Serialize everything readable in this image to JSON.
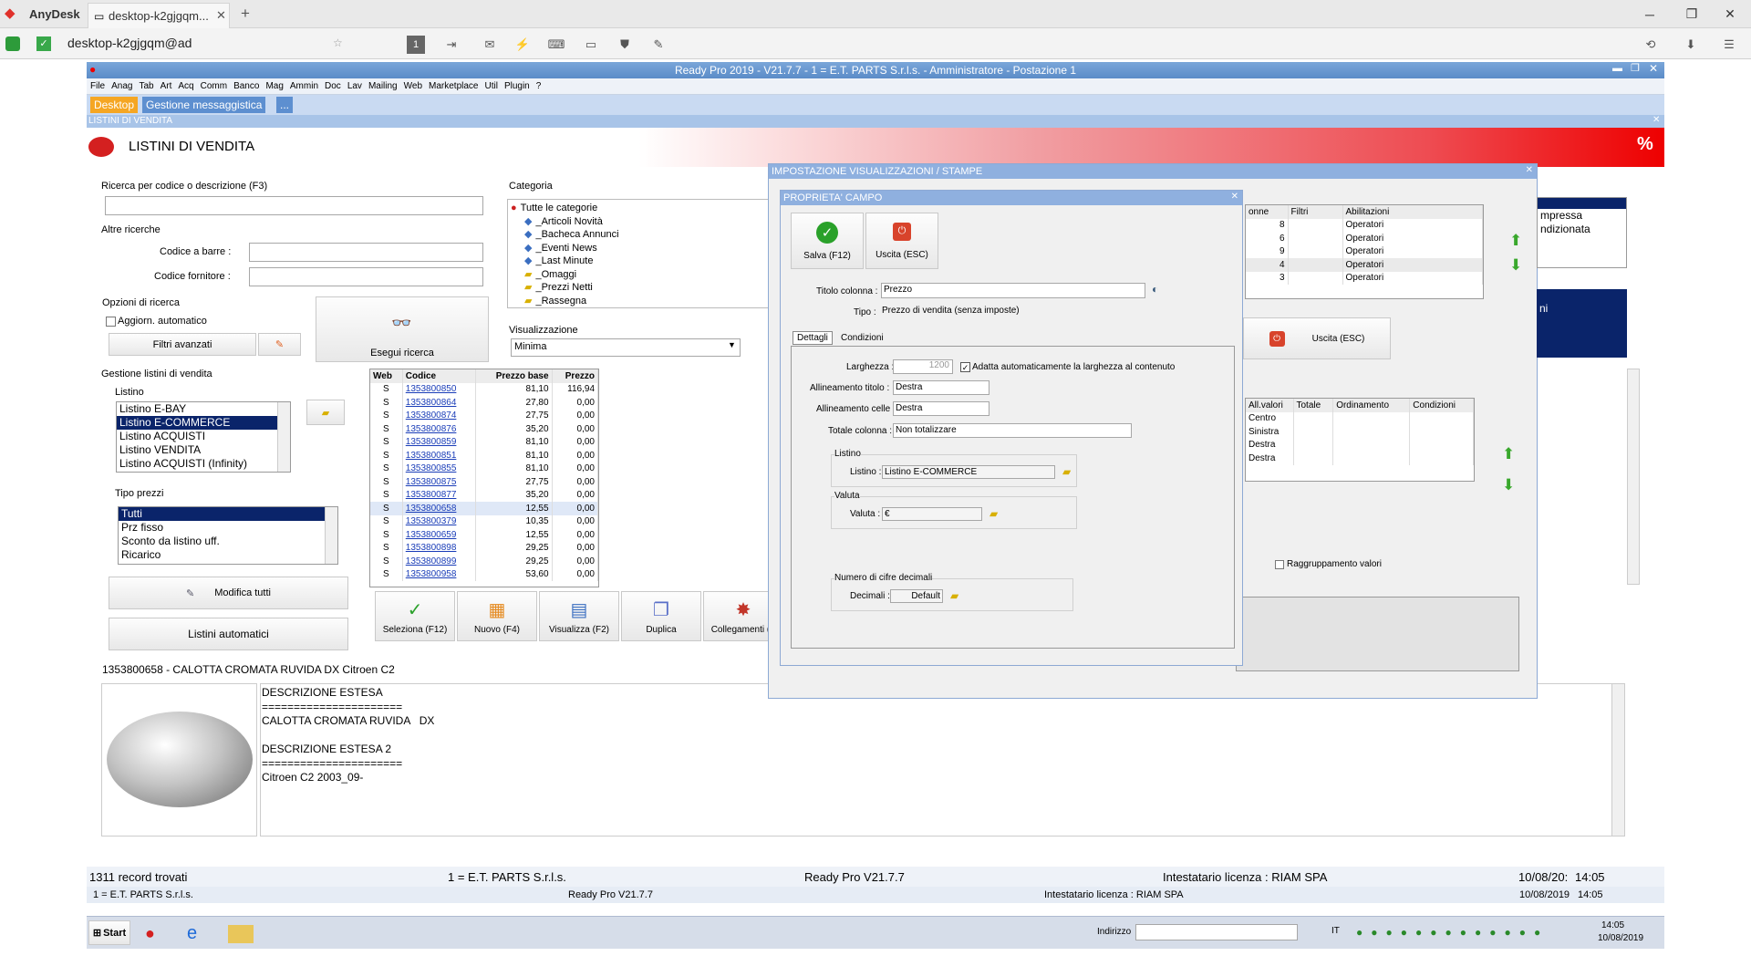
{
  "anydesk": {
    "brand": "AnyDesk",
    "tab_title": "desktop-k2gjgqm...",
    "address": "desktop-k2gjgqm@ad"
  },
  "app": {
    "title": "Ready Pro 2019 - V21.7.7 - 1 = E.T. PARTS S.r.l.s. - Amministratore - Postazione 1",
    "menu": [
      "File",
      "Anag",
      "Tab",
      "Art",
      "Acq",
      "Comm",
      "Banco",
      "Mag",
      "Ammin",
      "Doc",
      "Lav",
      "Mailing",
      "Web",
      "Marketplace",
      "Util",
      "Plugin",
      "?"
    ],
    "tabs": [
      "Desktop",
      "Gestione messaggistica",
      "..."
    ],
    "window_bar": "LISTINI DI VENDITA",
    "header_title": "LISTINI DI VENDITA"
  },
  "search": {
    "label": "Ricerca per codice o descrizione (F3)",
    "altre": "Altre ricerche",
    "barcode_label": "Codice a barre :",
    "fornitore_label": "Codice fornitore :",
    "opzioni": "Opzioni di ricerca",
    "auto_update": "Aggiorn. automatico",
    "filtri": "Filtri avanzati",
    "esegui": "Esegui ricerca"
  },
  "categoria": {
    "label": "Categoria",
    "items": [
      "Tutte le categorie",
      "_Articoli Novità",
      "_Bacheca Annunci",
      "_Eventi News",
      "_Last Minute",
      "_Omaggi",
      "_Prezzi Netti",
      "_Rassegna"
    ]
  },
  "visualizzazione": {
    "label": "Visualizzazione",
    "value": "Minima"
  },
  "gestione": {
    "label": "Gestione listini di vendita",
    "listino_label": "Listino",
    "listini": [
      "Listino E-BAY",
      "Listino E-COMMERCE",
      "Listino ACQUISTI",
      "Listino VENDITA",
      "Listino ACQUISTI (Infinity)"
    ],
    "tipo_label": "Tipo prezzi",
    "tipi": [
      "Tutti",
      "Prz fisso",
      "Sconto da listino uff.",
      "Ricarico"
    ],
    "modifica": "Modifica tutti",
    "automatici": "Listini automatici"
  },
  "grid": {
    "headers": [
      "Web",
      "Codice",
      "Prezzo base",
      "Prezzo"
    ],
    "rows": [
      [
        "S",
        "1353800850",
        "81,10",
        "116,94"
      ],
      [
        "S",
        "1353800864",
        "27,80",
        "0,00"
      ],
      [
        "S",
        "1353800874",
        "27,75",
        "0,00"
      ],
      [
        "S",
        "1353800876",
        "35,20",
        "0,00"
      ],
      [
        "S",
        "1353800859",
        "81,10",
        "0,00"
      ],
      [
        "S",
        "1353800851",
        "81,10",
        "0,00"
      ],
      [
        "S",
        "1353800855",
        "81,10",
        "0,00"
      ],
      [
        "S",
        "1353800875",
        "27,75",
        "0,00"
      ],
      [
        "S",
        "1353800877",
        "35,20",
        "0,00"
      ],
      [
        "S",
        "1353800658",
        "12,55",
        "0,00"
      ],
      [
        "S",
        "1353800379",
        "10,35",
        "0,00"
      ],
      [
        "S",
        "1353800659",
        "12,55",
        "0,00"
      ],
      [
        "S",
        "1353800898",
        "29,25",
        "0,00"
      ],
      [
        "S",
        "1353800899",
        "29,25",
        "0,00"
      ],
      [
        "S",
        "1353800958",
        "53,60",
        "0,00"
      ]
    ]
  },
  "actions": [
    "Seleziona (F12)",
    "Nuovo (F4)",
    "Visualizza (F2)",
    "Duplica",
    "Collegamenti (F"
  ],
  "detail": {
    "title": "1353800658 - CALOTTA CROMATA RUVIDA DX Citroen C2",
    "lines": [
      "DESCRIZIONE ESTESA",
      "======================",
      "CALOTTA CROMATA RUVIDA   DX",
      "",
      "DESCRIZIONE ESTESA 2",
      "======================",
      "Citroen C2 2003_09-"
    ]
  },
  "imp_dialog": {
    "title": "IMPOSTAZIONE VISUALIZZAZIONI / STAMPE",
    "top_headers": [
      "onne",
      "Filtri",
      "Abilitazioni"
    ],
    "top_rows": [
      [
        "8",
        "Operatori"
      ],
      [
        "6",
        "Operatori"
      ],
      [
        "9",
        "Operatori"
      ],
      [
        "4",
        "Operatori"
      ],
      [
        "3",
        "Operatori"
      ]
    ],
    "bottom_headers": [
      "All.valori",
      "Totale",
      "Ordinamento",
      "Condizioni"
    ],
    "bottom_rows": [
      "Centro",
      "Sinistra",
      "Destra",
      "Destra"
    ],
    "uscita": "Uscita (ESC)",
    "raggruppamento": "Raggruppamento valori",
    "right_list": [
      "mpressa",
      "ndizionata"
    ],
    "right_list2": "ni"
  },
  "prop_dialog": {
    "title": "PROPRIETA' CAMPO",
    "salva": "Salva (F12)",
    "uscita": "Uscita (ESC)",
    "titolo_label": "Titolo colonna :",
    "titolo_value": "Prezzo",
    "tipo_label": "Tipo :",
    "tipo_value": "Prezzo di vendita (senza imposte)",
    "tab_dettagli": "Dettagli",
    "tab_condizioni": "Condizioni",
    "larghezza_label": "Larghezza :",
    "larghezza_value": "1200",
    "adatta": "Adatta automaticamente la larghezza al contenuto",
    "allin_titolo_label": "Allineamento titolo :",
    "allin_titolo": "Destra",
    "allin_celle_label": "Allineamento celle :",
    "allin_celle": "Destra",
    "totale_label": "Totale colonna :",
    "totale": "Non totalizzare",
    "listino_group": "Listino",
    "listino_label": "Listino :",
    "listino_value": "Listino E-COMMERCE",
    "valuta_group": "Valuta",
    "valuta_label": "Valuta :",
    "valuta_value": "€",
    "decimali_group": "Numero di cifre decimali",
    "decimali_label": "Decimali :",
    "decimali_value": "Default"
  },
  "status": {
    "records": "1311 record trovati",
    "company": "1 = E.T. PARTS S.r.l.s.",
    "version": "Ready Pro V21.7.7",
    "licenza": "Intestatario licenza : RIAM SPA",
    "date": "10/08/20:",
    "time": "14:05",
    "company2": "1 = E.T. PARTS S.r.l.s.",
    "version2": "Ready Pro V21.7.7",
    "licenza2": "Intestatario licenza : RIAM SPA",
    "date2": "10/08/2019",
    "time2": "14:05"
  },
  "taskbar": {
    "start": "Start",
    "indirizzo": "Indirizzo",
    "lang": "IT",
    "clock_time": "14:05",
    "clock_date": "10/08/2019"
  }
}
